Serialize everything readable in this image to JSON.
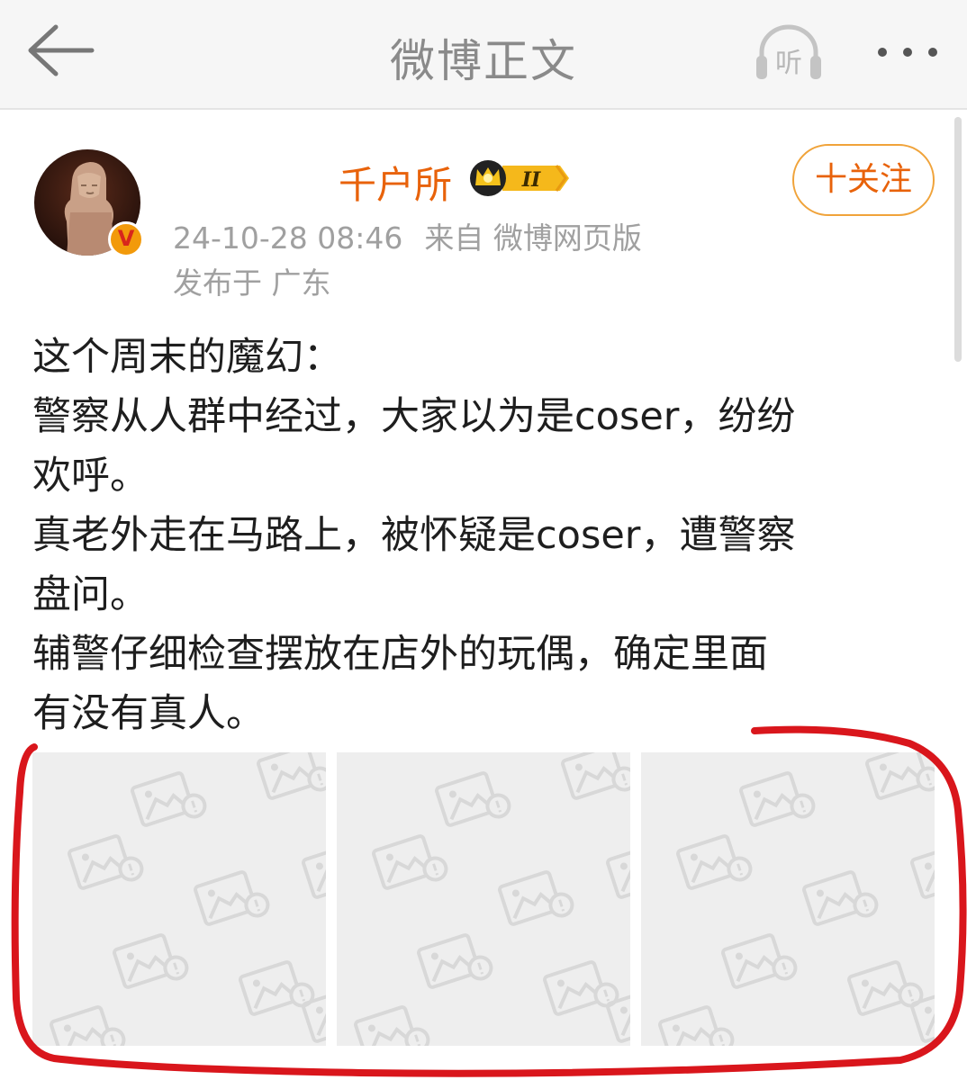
{
  "navbar": {
    "title": "微博正文",
    "back_icon": "back-arrow-icon",
    "listen_label": "听",
    "more_icon": "more-dots-icon"
  },
  "author": {
    "name": "千户所",
    "verified_mark": "V",
    "vip_level": "II",
    "follow_label": "十关注",
    "timestamp": "24-10-28 08:46",
    "source": "来自 微博网页版",
    "location": "发布于 广东"
  },
  "post": {
    "lines": [
      "这个周末的魔幻：",
      "警察从人群中经过，大家以为是coser，纷纷",
      "欢呼。",
      "真老外走在马路上，被怀疑是coser，遭警察",
      "盘问。",
      "辅警仔细检查摆放在店外的玩偶，确定里面",
      "有没有真人。"
    ]
  },
  "images": {
    "count": 3,
    "placeholder_icon": "image-placeholder-icon"
  },
  "colors": {
    "accent": "#e8620a",
    "follow_border": "#f0a33a",
    "annotation_red": "#d9161c",
    "tile_bg": "#eeeeee",
    "watermark": "#d8d8d8"
  }
}
